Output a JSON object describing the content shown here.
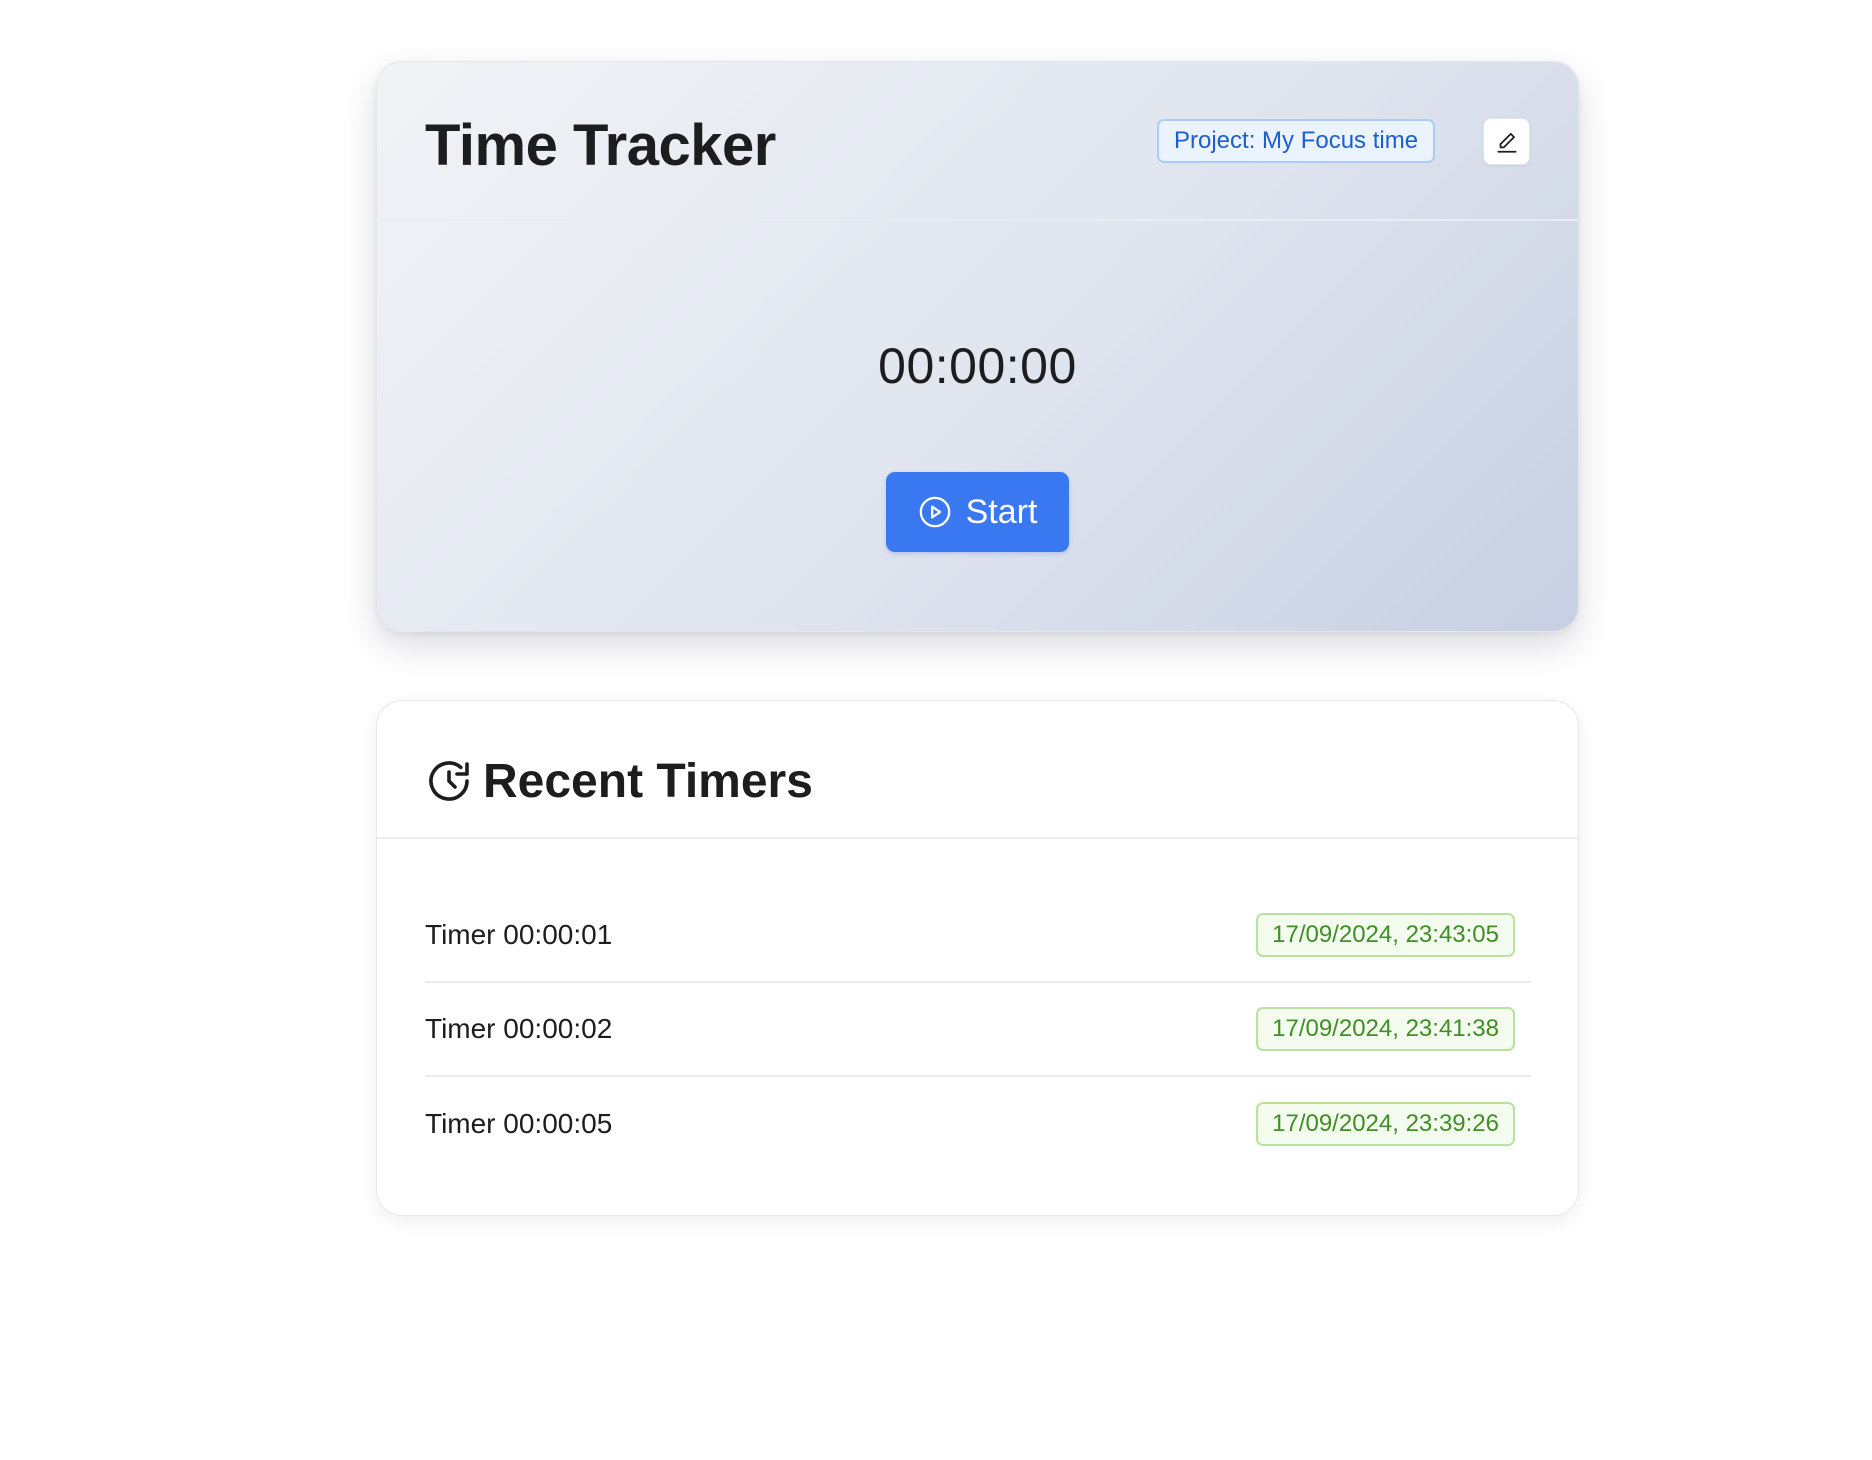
{
  "tracker": {
    "title": "Time Tracker",
    "project_label": "Project: My Focus time",
    "timer_value": "00:00:00",
    "start_label": "Start"
  },
  "recent": {
    "title": "Recent Timers",
    "items": [
      {
        "label": "Timer 00:00:01",
        "date": "17/09/2024, 23:43:05"
      },
      {
        "label": "Timer 00:00:02",
        "date": "17/09/2024, 23:41:38"
      },
      {
        "label": "Timer 00:00:05",
        "date": "17/09/2024, 23:39:26"
      }
    ]
  },
  "icons": {
    "edit": "pencil-icon",
    "start": "play-circle-icon",
    "recent": "history-icon"
  },
  "colors": {
    "primary": "#3a78f2",
    "project_tag_text": "#1d5fcf",
    "date_tag_text": "#3f8f24"
  }
}
